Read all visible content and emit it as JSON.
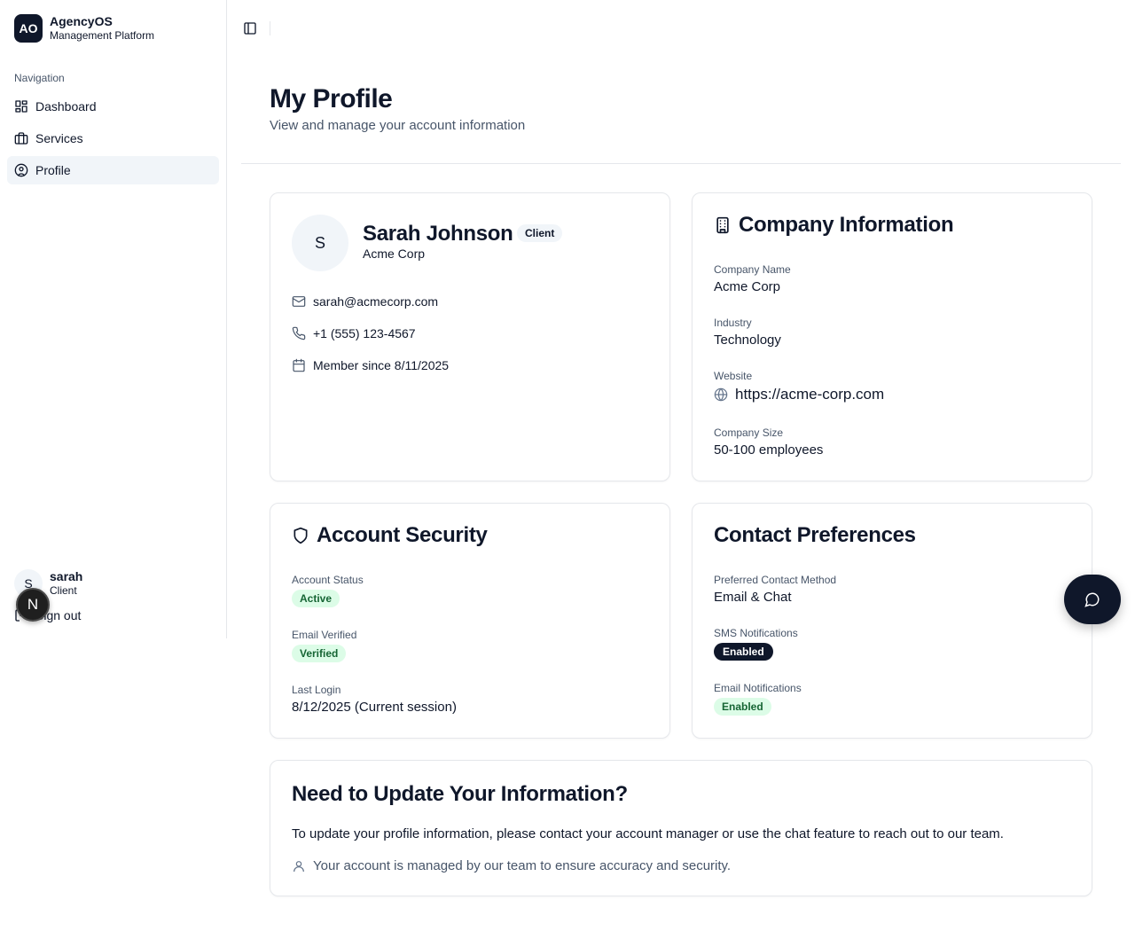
{
  "brand": {
    "logo": "AO",
    "name": "AgencyOS",
    "subtitle": "Management Platform"
  },
  "nav": {
    "label": "Navigation",
    "items": [
      {
        "label": "Dashboard",
        "icon": "dashboard-icon"
      },
      {
        "label": "Services",
        "icon": "briefcase-icon"
      },
      {
        "label": "Profile",
        "icon": "user-circle-icon",
        "active": true
      }
    ]
  },
  "user": {
    "initial": "S",
    "name": "sarah",
    "role": "Client",
    "signout": "Sign out"
  },
  "dev_badge": {
    "letter": "N"
  },
  "header": {
    "title": "My Profile",
    "subtitle": "View and manage your account information"
  },
  "profile": {
    "initial": "S",
    "name": "Sarah Johnson",
    "badge": "Client",
    "company": "Acme Corp",
    "email": "sarah@acmecorp.com",
    "phone": "+1 (555) 123-4567",
    "member_since": "Member since 8/11/2025"
  },
  "company": {
    "title": "Company Information",
    "name_label": "Company Name",
    "name_value": "Acme Corp",
    "industry_label": "Industry",
    "industry_value": "Technology",
    "website_label": "Website",
    "website_value": "https://acme-corp.com",
    "size_label": "Company Size",
    "size_value": "50-100 employees"
  },
  "security": {
    "title": "Account Security",
    "status_label": "Account Status",
    "status_value": "Active",
    "email_label": "Email Verified",
    "email_value": "Verified",
    "login_label": "Last Login",
    "login_value": "8/12/2025 (Current session)"
  },
  "preferences": {
    "title": "Contact Preferences",
    "method_label": "Preferred Contact Method",
    "method_value": "Email & Chat",
    "sms_label": "SMS Notifications",
    "sms_value": "Enabled",
    "emailnotif_label": "Email Notifications",
    "emailnotif_value": "Enabled"
  },
  "update": {
    "title": "Need to Update Your Information?",
    "text": "To update your profile information, please contact your account manager or use the chat feature to reach out to our team.",
    "note": "Your account is managed by our team to ensure accuracy and security."
  }
}
